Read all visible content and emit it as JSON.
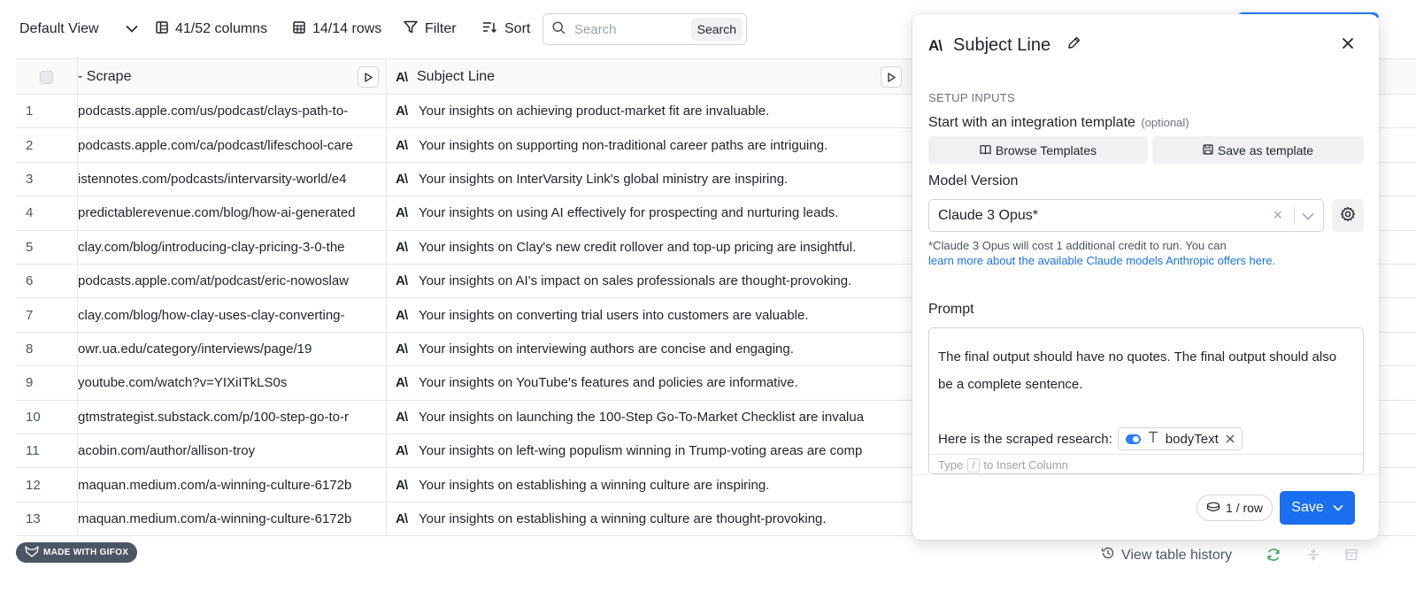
{
  "toolbar": {
    "view_label": "Default View",
    "columns_label": "41/52 columns",
    "rows_label": "14/14 rows",
    "filter_label": "Filter",
    "sort_label": "Sort",
    "search_placeholder": "Search",
    "search_button": "Search"
  },
  "table": {
    "headers": {
      "scrape": "- Scrape",
      "subject": "Subject Line"
    },
    "rows": [
      {
        "num": "1",
        "url": "podcasts.apple.com/us/podcast/clays-path-to-",
        "subject": "Your insights on achieving product-market fit are invaluable."
      },
      {
        "num": "2",
        "url": "podcasts.apple.com/ca/podcast/lifeschool-care",
        "subject": "Your insights on supporting non-traditional career paths are intriguing."
      },
      {
        "num": "3",
        "url": "istennotes.com/podcasts/intervarsity-world/e4",
        "subject": "Your insights on InterVarsity Link's global ministry are inspiring."
      },
      {
        "num": "4",
        "url": "predictablerevenue.com/blog/how-ai-generated",
        "subject": "Your insights on using AI effectively for prospecting and nurturing leads."
      },
      {
        "num": "5",
        "url": "clay.com/blog/introducing-clay-pricing-3-0-the",
        "subject": "Your insights on Clay's new credit rollover and top-up pricing are insightful."
      },
      {
        "num": "6",
        "url": "podcasts.apple.com/at/podcast/eric-nowoslaw",
        "subject": "Your insights on AI's impact on sales professionals are thought-provoking."
      },
      {
        "num": "7",
        "url": "clay.com/blog/how-clay-uses-clay-converting-",
        "subject": "Your insights on converting trial users into customers are valuable."
      },
      {
        "num": "8",
        "url": "owr.ua.edu/category/interviews/page/19",
        "subject": "Your insights on interviewing authors are concise and engaging."
      },
      {
        "num": "9",
        "url": "youtube.com/watch?v=YIXiITkLS0s",
        "subject": "Your insights on YouTube's features and policies are informative."
      },
      {
        "num": "10",
        "url": "gtmstrategist.substack.com/p/100-step-go-to-r",
        "subject": "Your insights on launching the 100-Step Go-To-Market Checklist are invalua"
      },
      {
        "num": "11",
        "url": "acobin.com/author/allison-troy",
        "subject": "Your insights on left-wing populism winning in Trump-voting areas are comp"
      },
      {
        "num": "12",
        "url": "maquan.medium.com/a-winning-culture-6172b",
        "subject": "Your insights on establishing a winning culture are inspiring."
      },
      {
        "num": "13",
        "url": "maquan.medium.com/a-winning-culture-6172b",
        "subject": "Your insights on establishing a winning culture are thought-provoking."
      }
    ]
  },
  "panel": {
    "title": "Subject Line",
    "section": "SETUP INPUTS",
    "template_label": "Start with an integration template",
    "template_optional": "(optional)",
    "browse_templates": "Browse Templates",
    "save_as_template": "Save as template",
    "model_label": "Model Version",
    "model_value": "Claude 3 Opus*",
    "model_note": "*Claude 3 Opus will cost 1 additional credit to run. You can",
    "model_link": "learn more about the available Claude models Anthropic offers here.",
    "prompt_label": "Prompt",
    "prompt_text": "The final output should have no quotes. The final output should also be a complete sentence.",
    "scraped_label": "Here is the scraped research:",
    "chip_label": "bodyText",
    "insert_hint_pre": "Type",
    "insert_hint_key": "/",
    "insert_hint_post": "to Insert Column",
    "credit_label": "1 / row",
    "save_label": "Save"
  },
  "bottom": {
    "gifox_label": "MADE WITH GIFOX",
    "history_label": "View table history"
  },
  "colors": {
    "accent": "#1a6ff0",
    "border": "#e5e7eb"
  }
}
